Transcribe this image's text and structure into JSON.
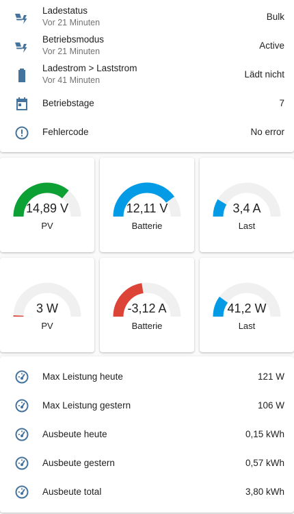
{
  "status_card": {
    "rows": [
      {
        "icon": "solar-power-icon",
        "name": "Ladestatus",
        "sub": "Vor 21 Minuten",
        "state": "Bulk"
      },
      {
        "icon": "solar-power-icon",
        "name": "Betriebsmodus",
        "sub": "Vor 21 Minuten",
        "state": "Active"
      },
      {
        "icon": "battery-icon",
        "name": "Ladestrom > Laststrom",
        "sub": "Vor 41 Minuten",
        "state": "Lädt nicht"
      },
      {
        "icon": "calendar-icon",
        "name": "Betriebstage",
        "state": "7"
      },
      {
        "icon": "alert-circle-icon",
        "name": "Fehlercode",
        "state": "No error"
      }
    ]
  },
  "gauges": [
    {
      "value": "14,89 V",
      "name": "PV",
      "level": 0.72,
      "color": "#0da035"
    },
    {
      "value": "12,11 V",
      "name": "Batterie",
      "level": 0.8,
      "color": "#039be5"
    },
    {
      "value": "3,4 A",
      "name": "Last",
      "level": 0.17,
      "color": "#039be5"
    },
    {
      "value": "3 W",
      "name": "PV",
      "level": 0.01,
      "color": "#db4437"
    },
    {
      "value": "-3,12 A",
      "name": "Batterie",
      "level": 0.45,
      "color": "#db4437"
    },
    {
      "value": "41,2 W",
      "name": "Last",
      "level": 0.2,
      "color": "#039be5"
    }
  ],
  "gauge_track_color": "#f0f0f0",
  "stats_card": {
    "rows": [
      {
        "icon": "gauge-icon",
        "name": "Max Leistung heute",
        "state": "121 W"
      },
      {
        "icon": "gauge-icon",
        "name": "Max Leistung gestern",
        "state": "106 W"
      },
      {
        "icon": "gauge-icon",
        "name": "Ausbeute heute",
        "state": "0,15 kWh"
      },
      {
        "icon": "gauge-icon",
        "name": "Ausbeute gestern",
        "state": "0,57 kWh"
      },
      {
        "icon": "gauge-icon",
        "name": "Ausbeute total",
        "state": "3,80 kWh"
      }
    ]
  },
  "icon_color": "#44739e"
}
